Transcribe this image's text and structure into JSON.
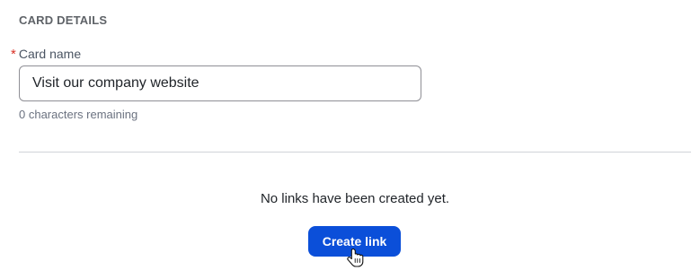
{
  "section": {
    "title": "CARD DETAILS"
  },
  "form": {
    "card_name": {
      "required_marker": "*",
      "label": "Card name",
      "value": "Visit our company website",
      "helper": "0 characters remaining"
    }
  },
  "links": {
    "empty_message": "No links have been created yet.",
    "create_label": "Create link"
  },
  "colors": {
    "primary_button": "#0b4fd9",
    "required": "#d93025",
    "divider": "#d0d3d8"
  },
  "icons": {
    "cursor": "pointer-hand-icon"
  }
}
